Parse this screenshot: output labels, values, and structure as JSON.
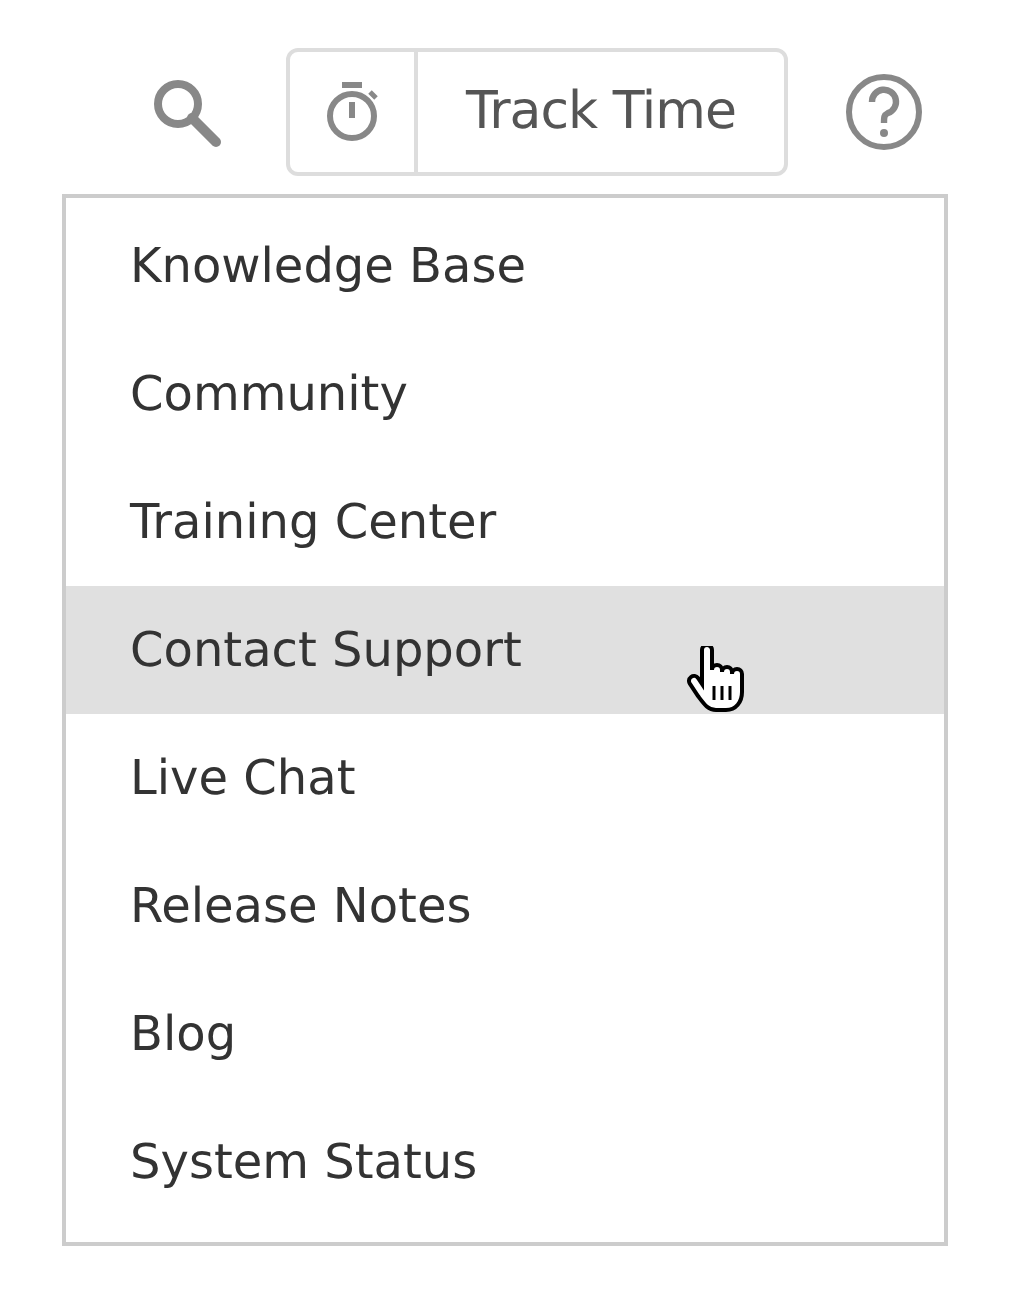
{
  "toolbar": {
    "track_button": {
      "label": "Track Time"
    }
  },
  "menu": {
    "items": [
      {
        "label": "Knowledge Base",
        "selected": false
      },
      {
        "label": "Community",
        "selected": false
      },
      {
        "label": "Training Center",
        "selected": false
      },
      {
        "label": "Contact Support",
        "selected": true
      },
      {
        "label": "Live Chat",
        "selected": false
      },
      {
        "label": "Release Notes",
        "selected": false
      },
      {
        "label": "Blog",
        "selected": false
      },
      {
        "label": "System Status",
        "selected": false
      }
    ]
  }
}
